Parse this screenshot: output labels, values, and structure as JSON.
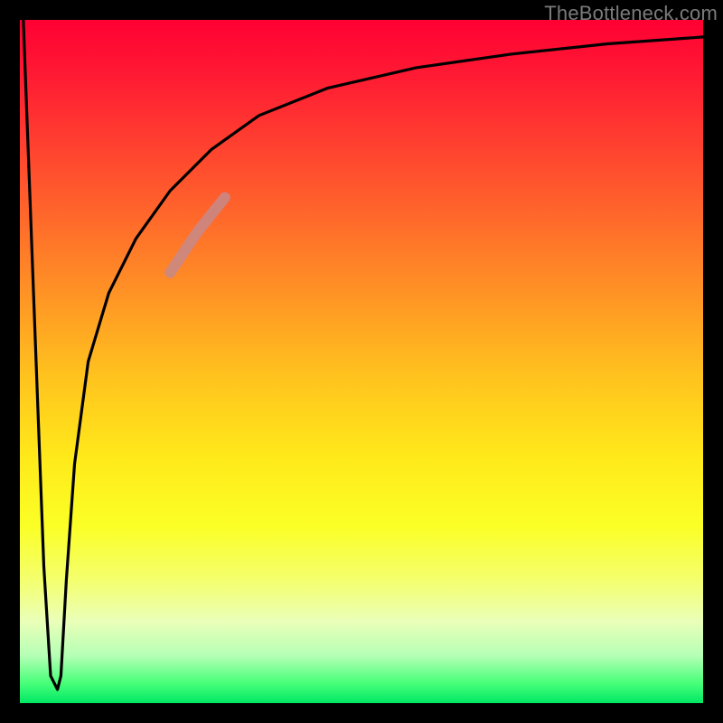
{
  "attribution": "TheBottleneck.com",
  "chart_data": {
    "type": "line",
    "title": "",
    "xlabel": "",
    "ylabel": "",
    "xlim": [
      0,
      100
    ],
    "ylim": [
      0,
      100
    ],
    "background_gradient": {
      "axis": "y",
      "stops": [
        {
          "pos": 0,
          "color": "#00e864"
        },
        {
          "pos": 7,
          "color": "#b6ffb6"
        },
        {
          "pos": 18,
          "color": "#f4ff6e"
        },
        {
          "pos": 36,
          "color": "#ffe91a"
        },
        {
          "pos": 62,
          "color": "#ff8b26"
        },
        {
          "pos": 92,
          "color": "#ff1a33"
        },
        {
          "pos": 100,
          "color": "#ff0033"
        }
      ]
    },
    "series": [
      {
        "name": "bottleneck-curve",
        "color": "#000000",
        "x": [
          0.5,
          2.0,
          3.5,
          4.5,
          5.5,
          6.0,
          6.8,
          8.0,
          10.0,
          13.0,
          17.0,
          22.0,
          28.0,
          35.0,
          45.0,
          58.0,
          72.0,
          86.0,
          100.0
        ],
        "y": [
          100,
          60,
          20,
          4,
          2,
          4,
          18,
          35,
          50,
          60,
          68,
          75,
          81,
          86,
          90,
          93,
          95,
          96.5,
          97.5
        ]
      },
      {
        "name": "highlight-segment",
        "color": "#c78a8a",
        "thickness": 12,
        "x": [
          22.0,
          24.0,
          26.0,
          28.0,
          30.0
        ],
        "y": [
          63.0,
          66.0,
          69.0,
          71.5,
          74.0
        ]
      }
    ],
    "annotations": []
  }
}
